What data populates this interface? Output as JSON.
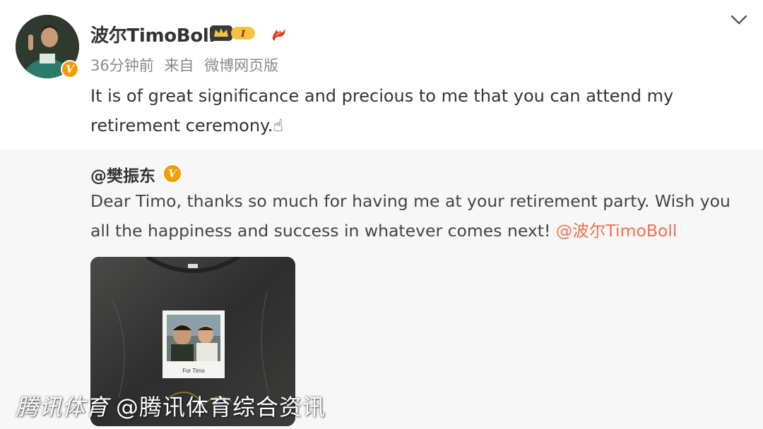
{
  "post": {
    "username": "波尔TimoBoll",
    "vip_level": "I",
    "timestamp": "36分钟前",
    "source_prefix": "来自",
    "source": "微博网页版",
    "text": "It is of great significance and precious to me that you can attend my retirement ceremony.☝"
  },
  "repost": {
    "username": "@樊振东",
    "text": "Dear Timo, thanks so much for having me at your retirement party. Wish you all the happiness and success in whatever comes next! ",
    "mention": "@波尔TimoBoll",
    "photo_caption": "For Timo"
  },
  "watermark": {
    "brand": "腾讯体育",
    "handle": "@腾讯体育综合资讯"
  },
  "colors": {
    "mention": "#eb7350",
    "verified": "#f59b00",
    "vip_gold": "#f5c242"
  }
}
